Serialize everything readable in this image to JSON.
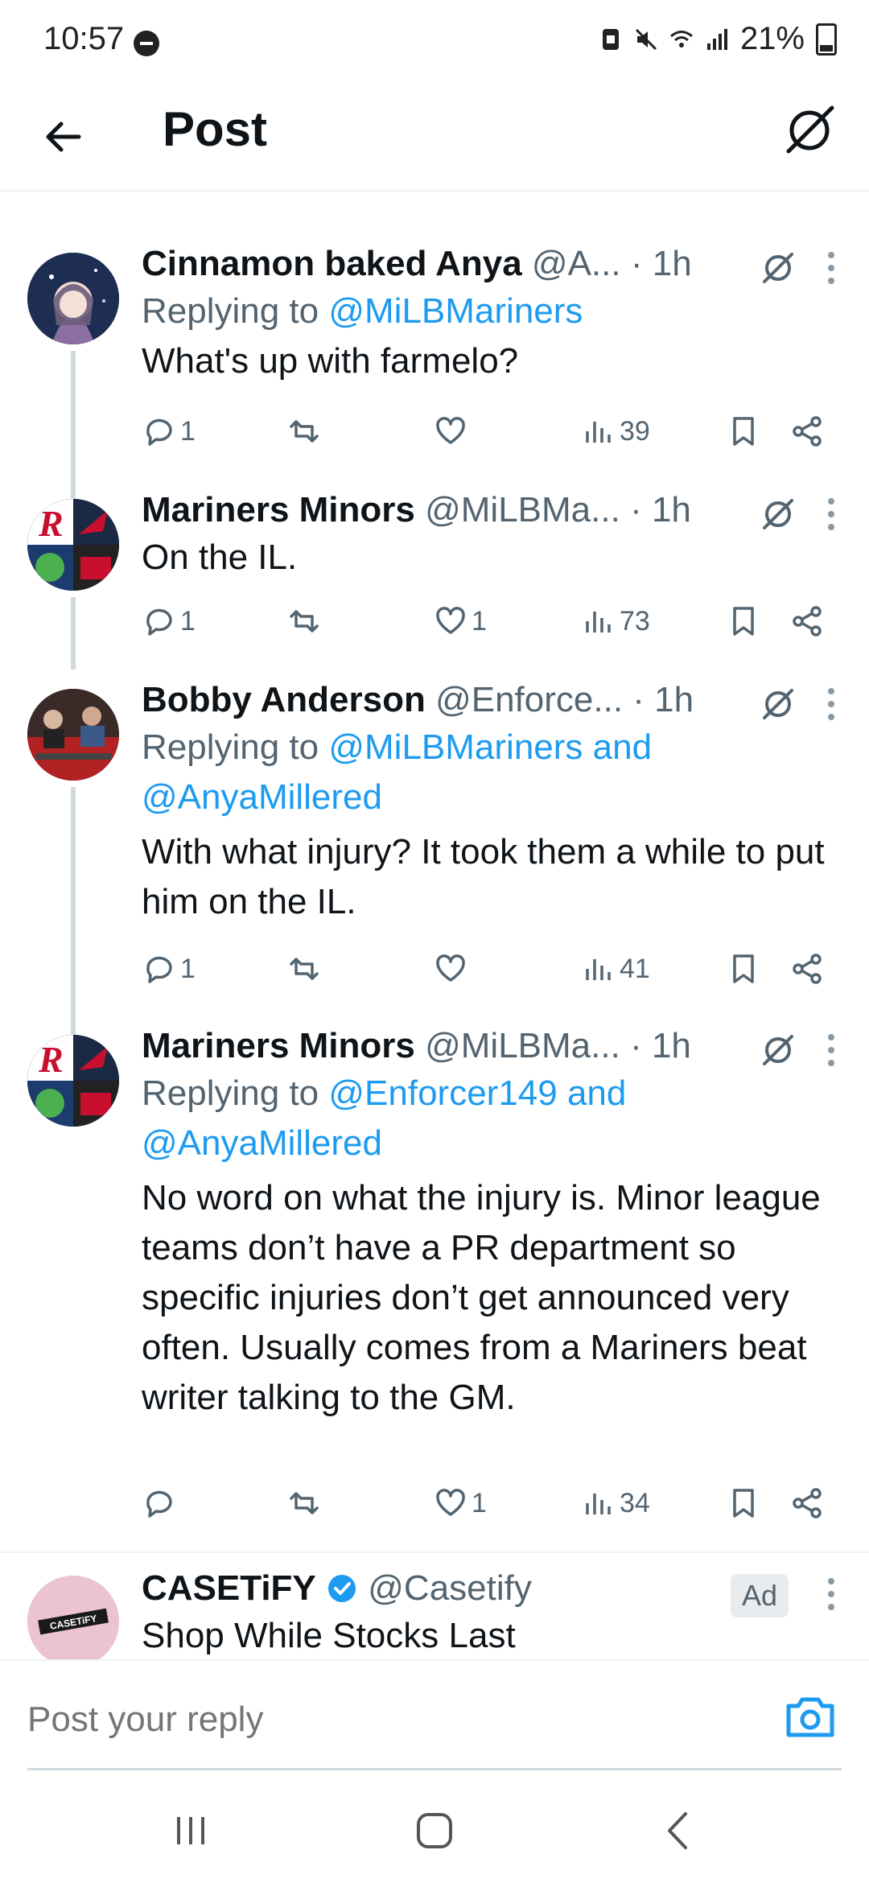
{
  "status_bar": {
    "time": "10:57",
    "battery": "21%"
  },
  "header": {
    "title": "Post"
  },
  "tweets": [
    {
      "name": "Cinnamon baked Anya",
      "handle": "@A...",
      "time": "· 1h",
      "replying_prefix": "Replying to ",
      "replying_to": "@MiLBMariners",
      "replying_to_2": "",
      "text": "What's up with farmelo?",
      "replies": "1",
      "retweets": "",
      "likes": "",
      "views": "39"
    },
    {
      "name": "Mariners Minors",
      "handle": "@MiLBMa...",
      "time": "· 1h",
      "replying_prefix": "",
      "replying_to": "",
      "replying_to_2": "",
      "text": "On the IL.",
      "replies": "1",
      "retweets": "",
      "likes": "1",
      "views": "73"
    },
    {
      "name": "Bobby Anderson",
      "handle": "@Enforce...",
      "time": "· 1h",
      "replying_prefix": "Replying to ",
      "replying_to": "@MiLBMariners and",
      "replying_to_2": "@AnyaMillered",
      "text": "With what injury? It took them a while to put him on the IL.",
      "replies": "1",
      "retweets": "",
      "likes": "",
      "views": "41"
    },
    {
      "name": "Mariners Minors",
      "handle": "@MiLBMa...",
      "time": "· 1h",
      "replying_prefix": "Replying to ",
      "replying_to": "@Enforcer149 and",
      "replying_to_2": "@AnyaMillered",
      "text": "No word on what the injury is. Minor league teams don’t have a PR department so specific injuries don’t get announced very often. Usually comes from a Mariners beat writer talking to the GM.",
      "replies": "",
      "retweets": "",
      "likes": "1",
      "views": "34"
    }
  ],
  "ad": {
    "name": "CASETiFY",
    "handle": "@Casetify",
    "badge": "Ad",
    "text": "Shop While Stocks Last",
    "logo_text": "CASETiFY"
  },
  "reply_box": {
    "placeholder": "Post your reply"
  },
  "colors": {
    "accent": "#1d9bf0",
    "secondary_text": "#536471",
    "primary_text": "#0f1419"
  }
}
